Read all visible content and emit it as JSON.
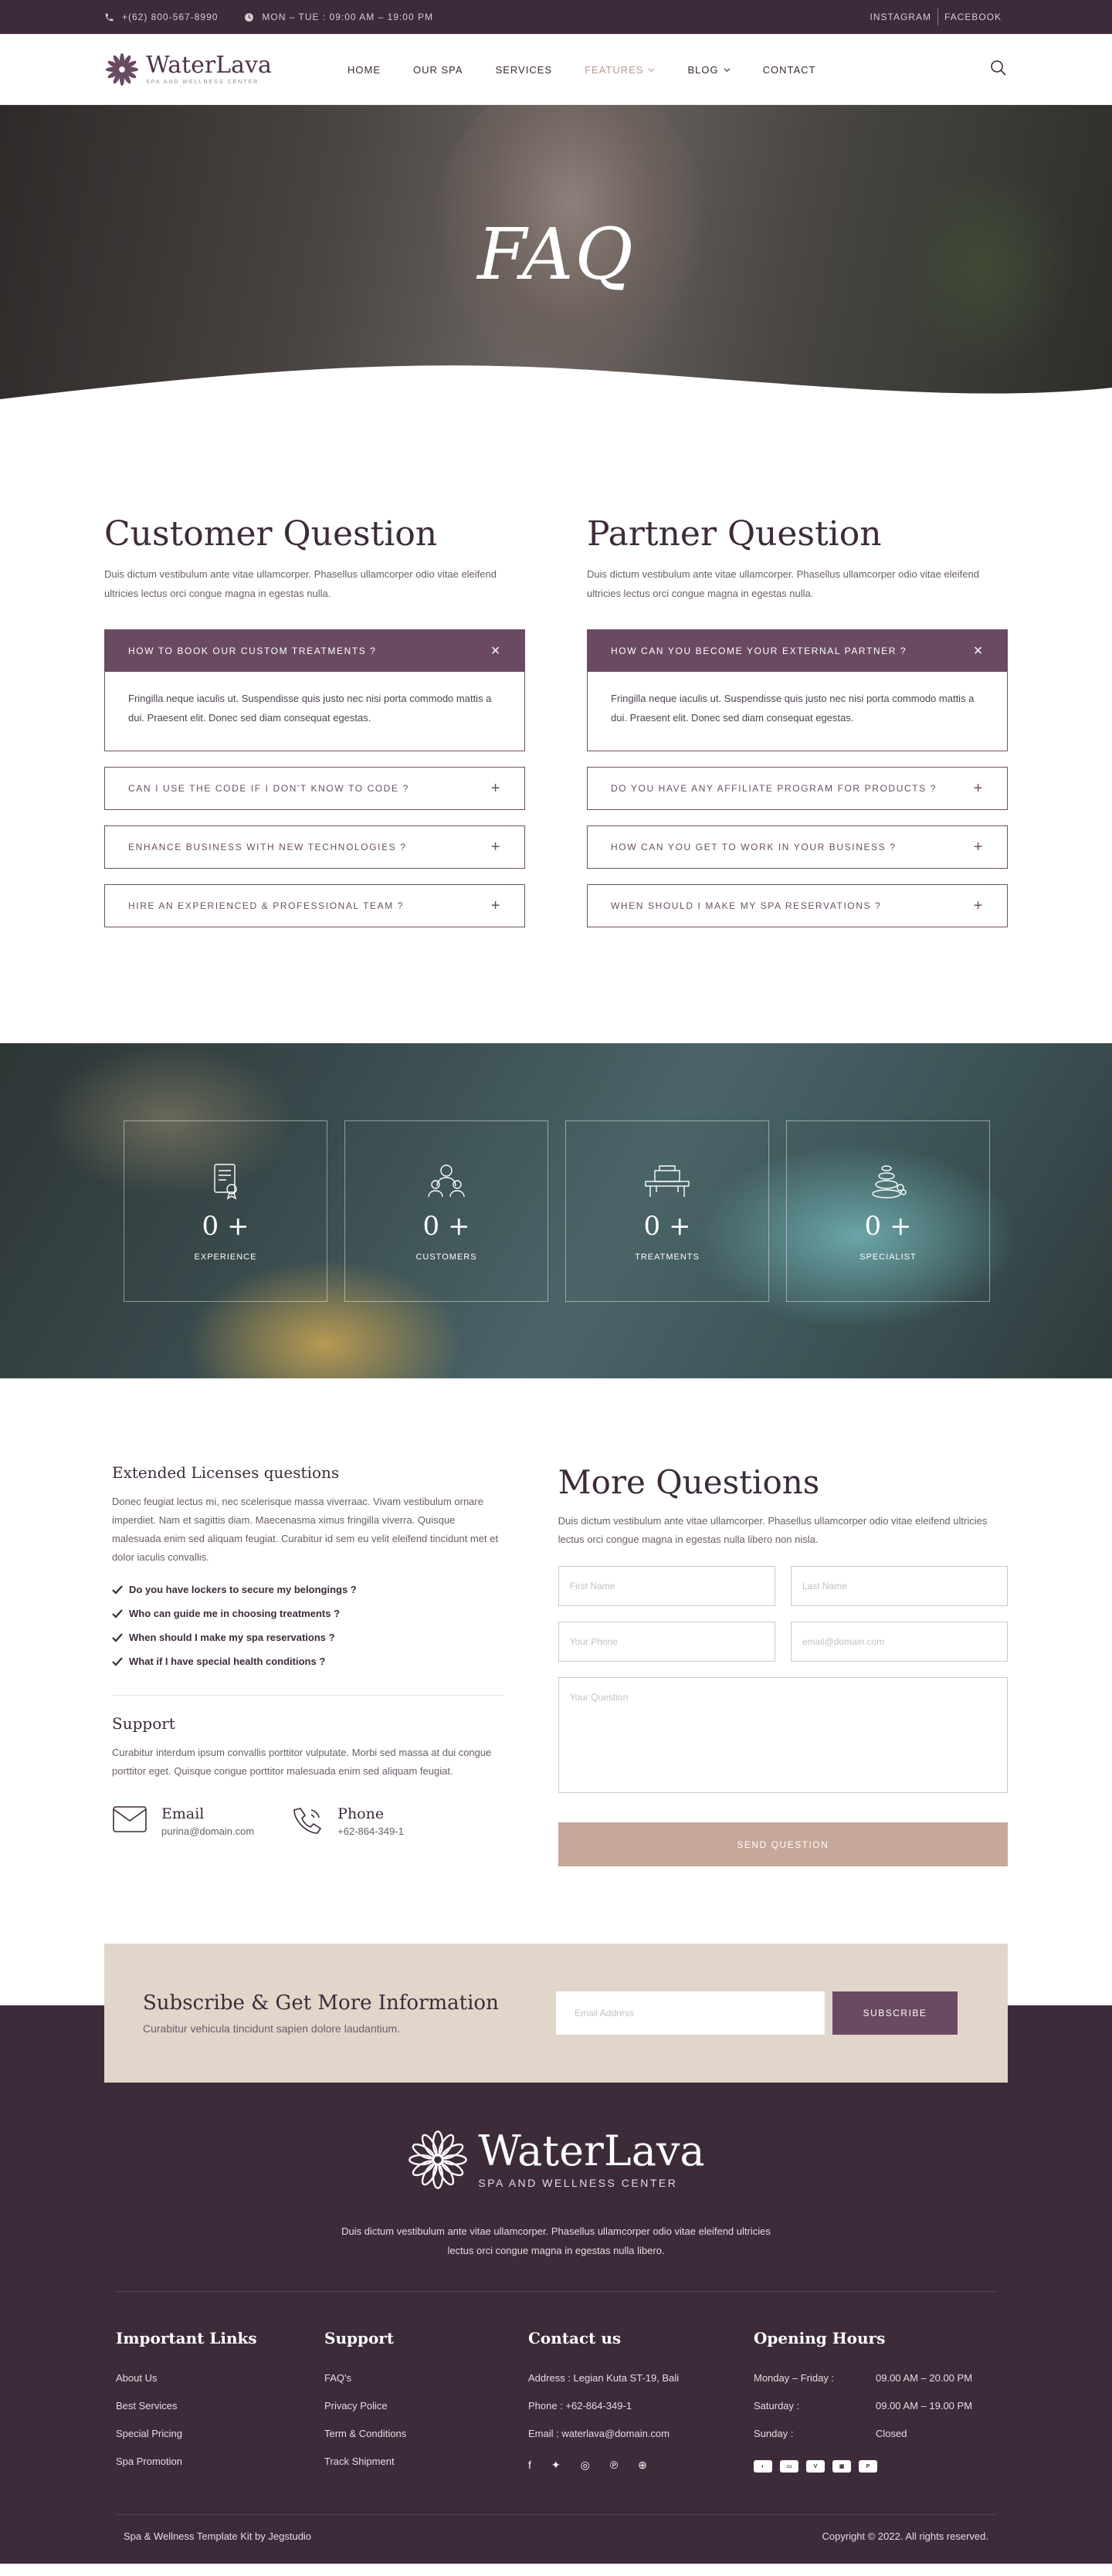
{
  "topbar": {
    "phone": "+(62) 800-567-8990",
    "hours": "MON – TUE : 09:00 AM – 19:00 PM",
    "links": [
      "INSTAGRAM",
      "FACEBOOK"
    ]
  },
  "header": {
    "logo_name": "WaterLava",
    "logo_tag": "SPA AND WELLNESS CENTER",
    "nav": [
      "HOME",
      "OUR SPA",
      "SERVICES",
      "FEATURES",
      "BLOG",
      "CONTACT"
    ]
  },
  "hero": {
    "title": "FAQ"
  },
  "faq": {
    "customer": {
      "title": "Customer Question",
      "desc": "Duis dictum vestibulum ante vitae ullamcorper. Phasellus ullamcorper odio vitae eleifend ultricies lectus orci congue magna in egestas nulla.",
      "open_q": "HOW TO BOOK OUR CUSTOM TREATMENTS ?",
      "open_a": "Fringilla neque iaculis ut. Suspendisse quis justo nec nisi porta commodo mattis a dui. Praesent elit. Donec sed diam consequat egestas.",
      "q": [
        "CAN I USE THE CODE IF I DON'T KNOW TO CODE ?",
        "ENHANCE BUSINESS WITH NEW TECHNOLOGIES ?",
        "HIRE AN EXPERIENCED & PROFESSIONAL TEAM ?"
      ]
    },
    "partner": {
      "title": "Partner Question",
      "desc": "Duis dictum vestibulum ante vitae ullamcorper. Phasellus ullamcorper odio vitae eleifend ultricies lectus orci congue magna in egestas nulla.",
      "open_q": "HOW CAN YOU BECOME YOUR EXTERNAL PARTNER ?",
      "open_a": "Fringilla neque iaculis ut. Suspendisse quis justo nec nisi porta commodo mattis a dui. Praesent elit. Donec sed diam consequat egestas.",
      "q": [
        "DO YOU HAVE ANY AFFILIATE PROGRAM FOR PRODUCTS ?",
        "HOW CAN YOU GET TO WORK IN YOUR BUSINESS ?",
        "WHEN SHOULD I MAKE MY SPA RESERVATIONS ?"
      ]
    }
  },
  "stats": [
    {
      "num": "0 +",
      "label": "EXPERIENCE",
      "icon": "certificate-icon"
    },
    {
      "num": "0 +",
      "label": "CUSTOMERS",
      "icon": "people-icon"
    },
    {
      "num": "0 +",
      "label": "TREATMENTS",
      "icon": "massage-table-icon"
    },
    {
      "num": "0 +",
      "label": "SPECIALIST",
      "icon": "spa-stones-icon"
    }
  ],
  "more": {
    "ext_title": "Extended Licenses questions",
    "ext_desc": "Donec feugiat lectus mi, nec scelerisque massa viverraac. Vivam vestibulum ornare imperdiet. Nam et sagittis diam. Maecenasma ximus fringilla viverra. Quisque malesuada enim sed aliquam feugiat. Curabitur id sem eu velit eleifend tincidunt met et dolor iaculis convallis.",
    "checks": [
      "Do you have lockers to secure my belongings ?",
      "Who can guide me in choosing treatments ?",
      "When should I make my spa reservations ?",
      "What if I have special health conditions ?"
    ],
    "support_title": "Support",
    "support_desc": "Curabitur interdum ipsum convallis porttitor vulputate. Morbi sed massa at dui congue porttitor eget. Quisque congue porttitor malesuada enim sed aliquam feugiat.",
    "email_label": "Email",
    "email_value": "purina@domain.com",
    "phone_label": "Phone",
    "phone_value": "+62-864-349-1",
    "form_title": "More Questions",
    "form_desc": "Duis dictum vestibulum ante vitae ullamcorper. Phasellus ullamcorper odio vitae eleifend ultricies lectus orci congue magna in egestas nulla libero non nisla.",
    "ph_first": "First Name",
    "ph_last": "Last Name",
    "ph_phone": "Your Phone",
    "ph_email": "email@domain.com",
    "ph_question": "Your Question",
    "send": "SEND QUESTION"
  },
  "subscribe": {
    "title": "Subscribe & Get More Information",
    "desc": "Curabitur vehicula tincidunt sapien dolore laudantium.",
    "placeholder": "Email Address",
    "button": "SUBSCRIBE"
  },
  "footer": {
    "logo_name": "WaterLava",
    "logo_tag": "SPA AND WELLNESS CENTER",
    "desc": "Duis dictum vestibulum ante vitae ullamcorper. Phasellus ullamcorper odio vitae eleifend ultricies lectus orci congue magna in egestas nulla libero.",
    "links_title": "Important Links",
    "links": [
      "About Us",
      "Best Services",
      "Special Pricing",
      "Spa Promotion"
    ],
    "support_title": "Support",
    "support": [
      "FAQ's",
      "Privacy Police",
      "Term & Conditions",
      "Track Shipment"
    ],
    "contact_title": "Contact us",
    "contact": [
      "Address : Legian Kuta ST-19, Bali",
      "Phone : +62-864-349-1",
      "Email : waterlava@domain.com"
    ],
    "hours_title": "Opening Hours",
    "hours": [
      {
        "day": "Monday – Friday :",
        "time": "09.00 AM – 20.00 PM"
      },
      {
        "day": "Saturday :",
        "time": "09.00 AM – 19.00 PM"
      },
      {
        "day": "Sunday :",
        "time": "Closed"
      }
    ],
    "credit": "Spa & Wellness Template Kit by Jegstudio",
    "copyright": "Copyright © 2022. All rights reserved."
  },
  "colors": {
    "primary": "#3d2b3a",
    "accent": "#6a4a63",
    "sand": "#e2d5c9",
    "button": "#c6a898"
  }
}
